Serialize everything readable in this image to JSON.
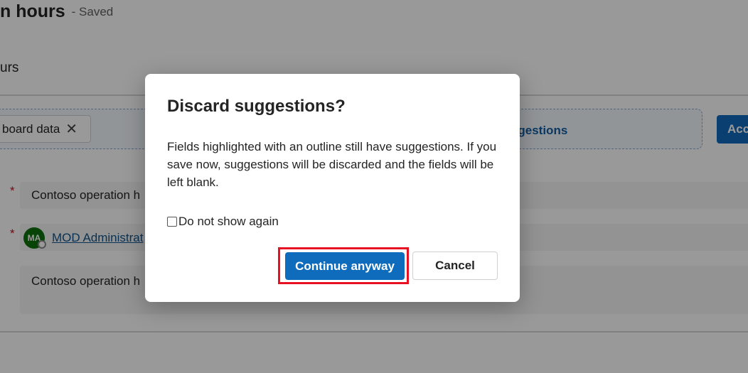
{
  "page": {
    "title": "n hours",
    "status": "- Saved",
    "section_label": "urs",
    "suggestion_chip": {
      "label": "board data"
    },
    "suggestions_link": "ggestions",
    "accept_button": "Acc",
    "fields": {
      "name_value": "Contoso operation h",
      "owner_initials": "MA",
      "owner_name": "MOD Administrat",
      "description_value": "Contoso operation h"
    }
  },
  "dialog": {
    "title": "Discard suggestions?",
    "body": "Fields highlighted with an outline still have suggestions. If you save now, suggestions will be discarded and the fields will be left blank.",
    "checkbox_label": "Do not show again",
    "continue_label": "Continue anyway",
    "cancel_label": "Cancel"
  },
  "colors": {
    "primary": "#0f6cbd",
    "highlight": "#e81123",
    "required": "#c50f1f",
    "avatar": "#0e700e"
  },
  "icons": {
    "chip_close": "close-icon"
  }
}
